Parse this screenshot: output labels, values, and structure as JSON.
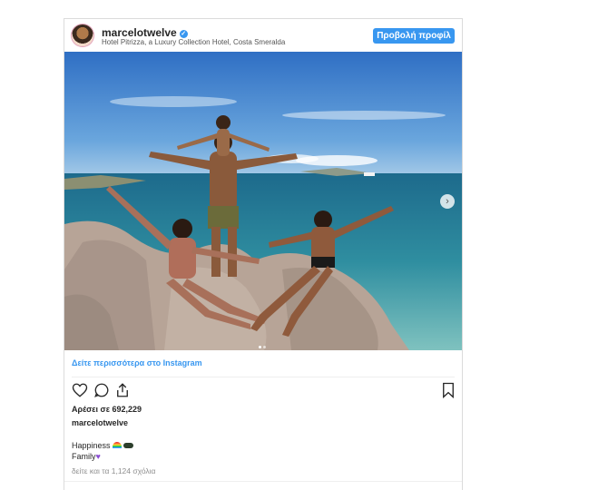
{
  "post": {
    "username": "marcelotwelve",
    "location": "Hotel Pitrizza, a Luxury Collection Hotel, Costa Smeralda",
    "profile_button": "Προβολή προφίλ",
    "view_more_link": "Δείτε περισσότερα στο Instagram",
    "likes": "Αρέσει σε 692,229",
    "caption_user": "marcelotwelve",
    "caption_line1": "Happiness",
    "caption_line2": "Family",
    "comments_link": "δείτε και τα 1,124 σχόλια"
  },
  "icons": {
    "verified": "verified-badge-icon",
    "like": "heart-icon",
    "comment": "comment-icon",
    "share": "share-icon",
    "save": "bookmark-icon",
    "next": "chevron-right-icon",
    "emoji1": "rainbow-emoji",
    "emoji2": "sunglasses-emoji",
    "emoji3": "purple-heart-emoji"
  },
  "colors": {
    "accent": "#3897f0",
    "sky": "#3f7fcf",
    "sea": "#2e7f99",
    "rock": "#b8a79a"
  }
}
